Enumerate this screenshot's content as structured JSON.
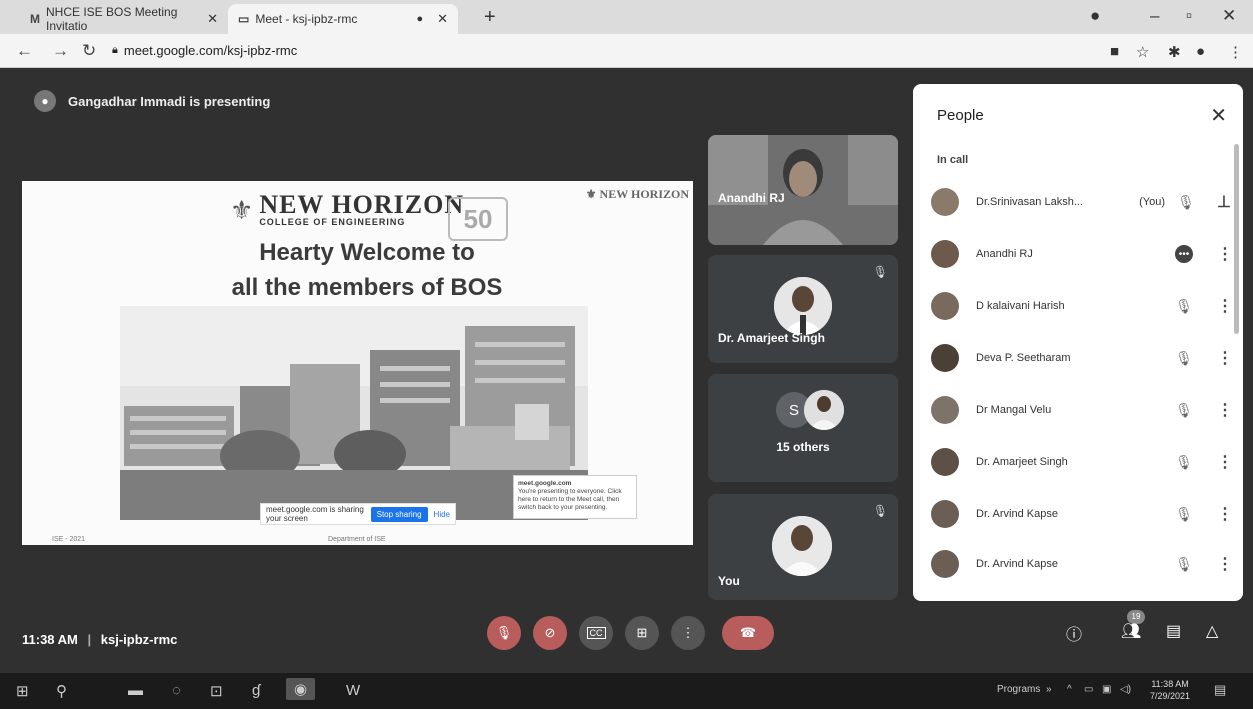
{
  "browser": {
    "tabs": [
      {
        "icon": "gmail-icon",
        "favicon": "M",
        "title": "NHCE ISE BOS Meeting Invitatio"
      },
      {
        "icon": "meet-icon",
        "favicon": "▭",
        "title": "Meet - ksj-ipbz-rmc"
      }
    ],
    "url": "meet.google.com/ksj-ipbz-rmc"
  },
  "meet": {
    "presenting_text": "Gangadhar Immadi is presenting",
    "slide": {
      "logo_name": "NEW HORIZON",
      "logo_sub": "COLLEGE OF ENGINEERING",
      "fifty": "50",
      "headline_1": "Hearty Welcome to",
      "headline_2": "all the members of BOS",
      "share_text": "meet.google.com is sharing your screen",
      "stop_label": "Stop sharing",
      "hide_label": "Hide",
      "notice_title": "meet.google.com",
      "notice_text": "You're presenting to everyone. Click here to return to the Meet call, then switch back to your presenting.",
      "footer_left": "ISE - 2021",
      "footer_mid": "Department of ISE"
    },
    "tiles": [
      {
        "name": "Anandhi RJ"
      },
      {
        "name": "Dr. Amarjeet Singh"
      },
      {
        "name": "15 others",
        "initial": "S"
      },
      {
        "name": "You"
      }
    ],
    "people": {
      "title": "People",
      "section": "In call",
      "you_label": "(You)",
      "rows": [
        {
          "name": "Dr.Srinivasan Laksh...",
          "you": true
        },
        {
          "name": "Anandhi RJ",
          "speaking": true
        },
        {
          "name": "D kalaivani Harish"
        },
        {
          "name": "Deva P. Seetharam"
        },
        {
          "name": "Dr Mangal Velu"
        },
        {
          "name": "Dr. Amarjeet Singh"
        },
        {
          "name": "Dr. Arvind Kapse"
        },
        {
          "name": "Dr. Arvind Kapse"
        }
      ]
    },
    "time": "11:38 AM",
    "meeting_code": "ksj-ipbz-rmc",
    "participant_count": "19"
  },
  "taskbar": {
    "programs_label": "Programs",
    "time": "11:38 AM",
    "date": "7/29/2021"
  },
  "colors": {
    "stage": "#303030",
    "tile": "#3c4043",
    "red": "#b85c5c",
    "accent": "#1a73e8"
  }
}
